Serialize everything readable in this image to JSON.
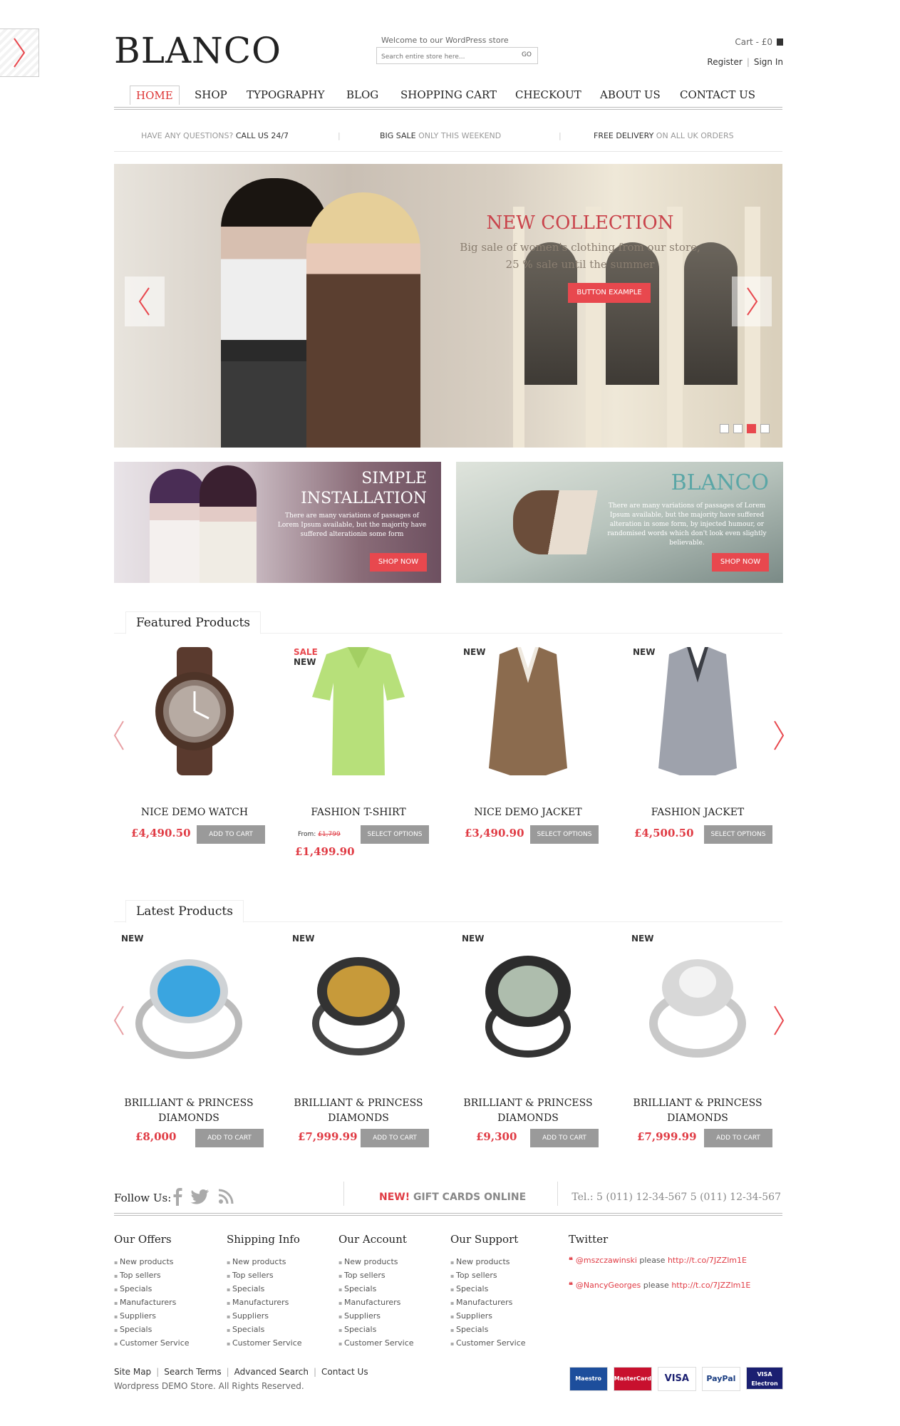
{
  "header": {
    "logo": "BLANCO",
    "welcome": "Welcome to our WordPress store",
    "search_placeholder": "Search entire store here...",
    "search_go": "GO",
    "cart": "Cart - £0",
    "register": "Register",
    "sign_in": "Sign In"
  },
  "nav": [
    "HOME",
    "SHOP",
    "TYPOGRAPHY",
    "BLOG",
    "SHOPPING CART",
    "CHECKOUT",
    "ABOUT US",
    "CONTACT US"
  ],
  "promo_strip": {
    "a_muted": "HAVE ANY QUESTIONS?",
    "a_strong": "CALL US 24/7",
    "b_strong": "BIG SALE",
    "b_muted": "ONLY THIS WEEKEND",
    "c_strong": "FREE DELIVERY",
    "c_muted": "ON ALL UK ORDERS"
  },
  "slider": {
    "title": "NEW COLLECTION",
    "line1": "Big sale of women's clothing from our store,",
    "line2": "25 % sale until the summer",
    "button": "BUTTON EXAMPLE",
    "active_dot": 3,
    "dot_count": 4
  },
  "banners": {
    "left": {
      "title1": "SIMPLE",
      "title2": "INSTALLATION",
      "text": "There are many variations of passages of Lorem Ipsum available, but the majority have suffered alterationin some form",
      "button": "SHOP NOW"
    },
    "right": {
      "title": "BLANCO",
      "text": "There are many variations of passages of Lorem Ipsum available, but the majority have suffered alteration in some form, by injected humour, or randomised words which don't look even slightly believable.",
      "button": "SHOP NOW"
    }
  },
  "featured": {
    "title": "Featured Products",
    "items": [
      {
        "badge": "",
        "badge2": "",
        "name": "NICE DEMO WATCH",
        "price": "£4,490.50",
        "from": "",
        "old": "",
        "button": "ADD TO CART"
      },
      {
        "badge": "SALE",
        "badge2": "NEW",
        "name": "FASHION T-SHIRT",
        "price": "£1,499.90",
        "from": "From:",
        "old": "£1,799",
        "button": "SELECT OPTIONS"
      },
      {
        "badge": "NEW",
        "badge2": "",
        "name": "NICE DEMO JACKET",
        "price": "£3,490.90",
        "from": "",
        "old": "",
        "button": "SELECT OPTIONS"
      },
      {
        "badge": "NEW",
        "badge2": "",
        "name": "FASHION JACKET",
        "price": "£4,500.50",
        "from": "",
        "old": "",
        "button": "SELECT OPTIONS"
      }
    ]
  },
  "latest": {
    "title": "Latest Products",
    "items": [
      {
        "badge": "NEW",
        "name1": "BRILLIANT & PRINCESS",
        "name2": "DIAMONDS",
        "price": "£8,000",
        "button": "ADD TO CART"
      },
      {
        "badge": "NEW",
        "name1": "BRILLIANT & PRINCESS",
        "name2": "DIAMONDS",
        "price": "£7,999.99",
        "button": "ADD TO CART"
      },
      {
        "badge": "NEW",
        "name1": "BRILLIANT & PRINCESS",
        "name2": "DIAMONDS",
        "price": "£9,300",
        "button": "ADD TO CART"
      },
      {
        "badge": "NEW",
        "name1": "BRILLIANT & PRINCESS",
        "name2": "DIAMONDS",
        "price": "£7,999.99",
        "button": "ADD TO CART"
      }
    ]
  },
  "footer_bar": {
    "follow": "Follow Us:",
    "gift_new": "NEW!",
    "gift_rest": "GIFT CARDS ONLINE",
    "tel": "Tel.:  5 (011) 12-34-567   5 (011) 12-34-567"
  },
  "footer_cols": [
    {
      "title": "Our Offers",
      "links": [
        "New products",
        "Top sellers",
        "Specials",
        "Manufacturers",
        "Suppliers",
        "Specials",
        "Customer Service"
      ]
    },
    {
      "title": "Shipping Info",
      "links": [
        "New products",
        "Top sellers",
        "Specials",
        "Manufacturers",
        "Suppliers",
        "Specials",
        "Customer Service"
      ]
    },
    {
      "title": "Our Account",
      "links": [
        "New products",
        "Top sellers",
        "Specials",
        "Manufacturers",
        "Suppliers",
        "Specials",
        "Customer Service"
      ]
    },
    {
      "title": "Our Support",
      "links": [
        "New products",
        "Top sellers",
        "Specials",
        "Manufacturers",
        "Suppliers",
        "Specials",
        "Customer Service"
      ]
    }
  ],
  "twitter": {
    "title": "Twitter",
    "tweets": [
      {
        "user": "@mszczawinski",
        "text": " please ",
        "link": "http://t.co/7JZZlm1E"
      },
      {
        "user": "@NancyGeorges",
        "text": " please ",
        "link": "http://t.co/7JZZlm1E"
      }
    ]
  },
  "bottom": {
    "links": [
      "Site Map",
      "Search Terms",
      "Advanced Search",
      "Contact Us"
    ],
    "copyright": "Wordpress DEMO Store. All Rights Reserved.",
    "cards": [
      "Maestro",
      "MasterCard",
      "VISA",
      "PayPal",
      "VISA Electron"
    ]
  },
  "colors": {
    "accent": "#e8484e",
    "price": "#e03b44",
    "button_gray": "#9a9a9a"
  }
}
